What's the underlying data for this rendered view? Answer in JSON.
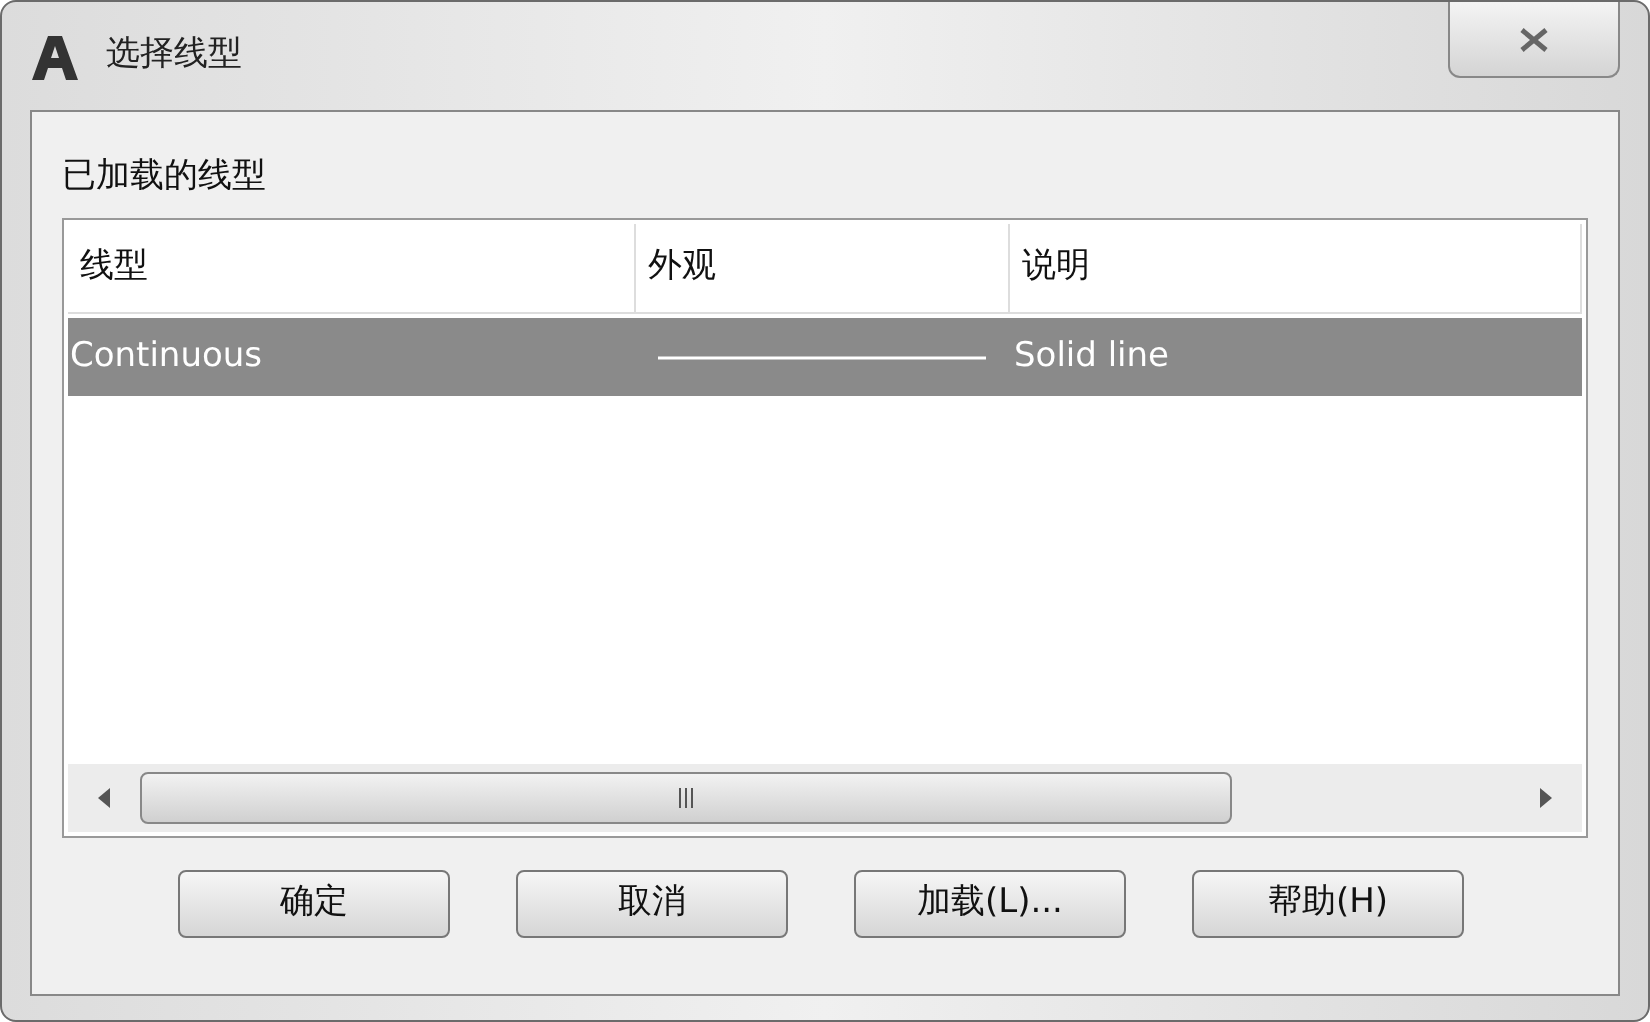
{
  "window": {
    "title": "选择线型"
  },
  "section_label": "已加载的线型",
  "table": {
    "columns": [
      "线型",
      "外观",
      "说明"
    ],
    "rows": [
      {
        "name": "Continuous",
        "kind": "solid",
        "description": "Solid line",
        "selected": true
      }
    ]
  },
  "buttons": [
    "确定",
    "取消",
    "加载(L)...",
    "帮助(H)"
  ]
}
